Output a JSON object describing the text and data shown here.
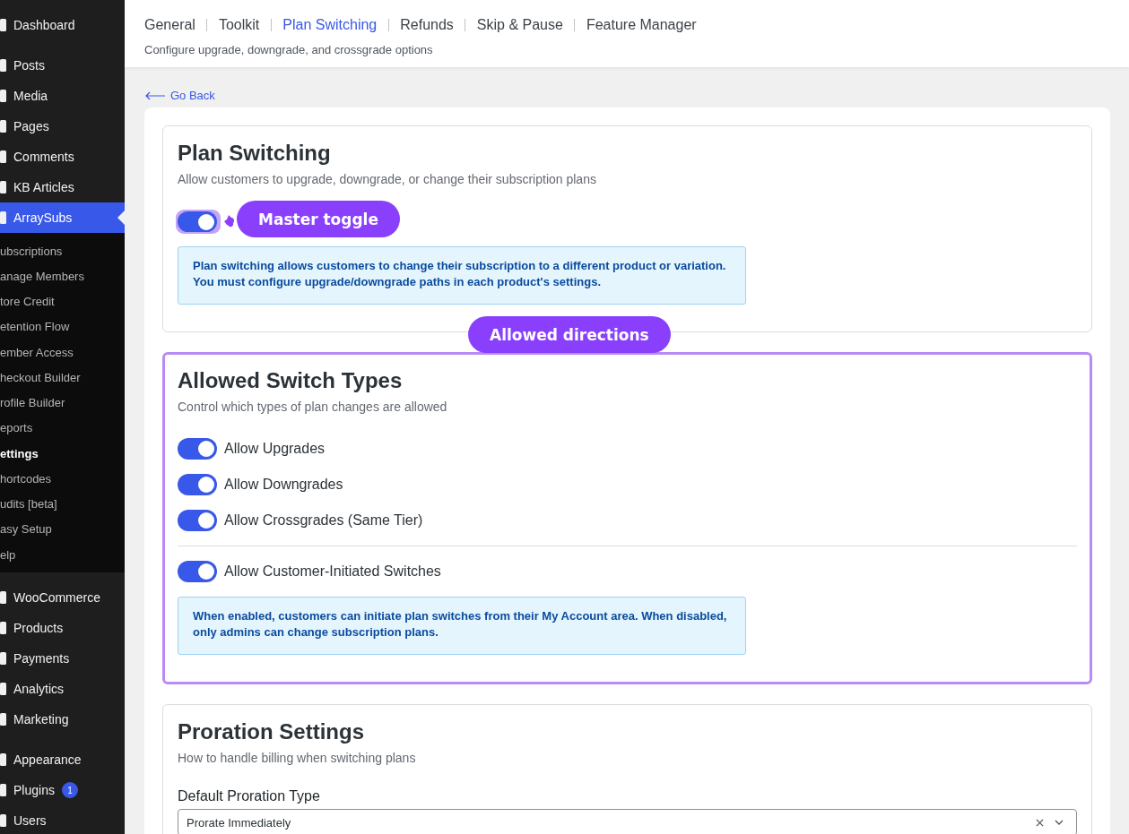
{
  "sidebar": {
    "groups": [
      [
        {
          "label": "Dashboard",
          "selected": false
        }
      ],
      [
        {
          "label": "Posts",
          "selected": false
        },
        {
          "label": "Media",
          "selected": false
        },
        {
          "label": "Pages",
          "selected": false
        },
        {
          "label": "Comments",
          "selected": false
        },
        {
          "label": "KB Articles",
          "selected": false
        },
        {
          "label": "ArraySubs",
          "selected": true,
          "children": [
            {
              "label": "ubscriptions",
              "selected": false
            },
            {
              "label": "anage Members",
              "selected": false
            },
            {
              "label": "tore Credit",
              "selected": false
            },
            {
              "label": "etention Flow",
              "selected": false
            },
            {
              "label": "ember Access",
              "selected": false
            },
            {
              "label": "heckout Builder",
              "selected": false
            },
            {
              "label": "rofile Builder",
              "selected": false
            },
            {
              "label": "eports",
              "selected": false
            },
            {
              "label": "ettings",
              "selected": true
            },
            {
              "label": "hortcodes",
              "selected": false
            },
            {
              "label": "udits [beta]",
              "selected": false
            },
            {
              "label": "asy Setup",
              "selected": false
            },
            {
              "label": "elp",
              "selected": false
            }
          ]
        }
      ],
      [
        {
          "label": "WooCommerce",
          "selected": false
        },
        {
          "label": "Products",
          "selected": false
        },
        {
          "label": "Payments",
          "selected": false
        },
        {
          "label": "Analytics",
          "selected": false
        },
        {
          "label": "Marketing",
          "selected": false
        }
      ],
      [
        {
          "label": "Appearance",
          "selected": false
        },
        {
          "label": "Plugins",
          "selected": false,
          "badge": "1"
        },
        {
          "label": "Users",
          "selected": false
        }
      ]
    ]
  },
  "header": {
    "tabs": [
      {
        "label": "General",
        "selected": false
      },
      {
        "label": "Toolkit",
        "selected": false
      },
      {
        "label": "Plan Switching",
        "selected": true
      },
      {
        "label": "Refunds",
        "selected": false
      },
      {
        "label": "Skip & Pause",
        "selected": false
      },
      {
        "label": "Feature Manager",
        "selected": false
      }
    ],
    "subtitle": "Configure upgrade, downgrade, and crossgrade options"
  },
  "back_link": "Go Back",
  "sections": [
    {
      "title": "Plan Switching",
      "subtitle": "Allow customers to upgrade, downgrade, or change their subscription plans",
      "highlighted": false,
      "toggle_groups": [
        [
          {
            "on": true,
            "annotation": "Master toggle"
          }
        ]
      ],
      "info": "Plan switching allows customers to change their subscription to a different product or variation. You must configure upgrade/downgrade paths in each product's settings."
    },
    {
      "title": "Allowed Switch Types",
      "subtitle": "Control which types of plan changes are allowed",
      "highlighted": true,
      "annotation": "Allowed directions",
      "toggle_groups": [
        [
          {
            "label": "Allow Upgrades",
            "on": true
          },
          {
            "label": "Allow Downgrades",
            "on": true
          },
          {
            "label": "Allow Crossgrades (Same Tier)",
            "on": true
          }
        ],
        [
          {
            "label": "Allow Customer-Initiated Switches",
            "on": true
          }
        ]
      ],
      "info": "When enabled, customers can initiate plan switches from their My Account area. When disabled, only admins can change subscription plans."
    },
    {
      "title": "Proration Settings",
      "subtitle": "How to handle billing when switching plans",
      "highlighted": false,
      "field": {
        "label": "Default Proration Type",
        "value": "Prorate Immediately"
      }
    }
  ]
}
